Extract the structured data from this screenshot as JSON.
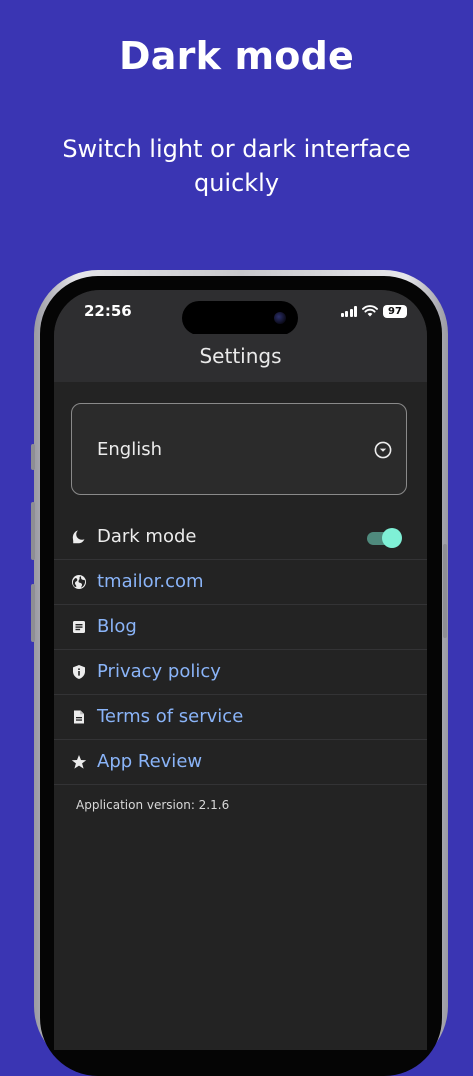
{
  "promo": {
    "headline": "Dark mode",
    "subline": "Switch light or dark interface quickly"
  },
  "status_bar": {
    "time": "22:56",
    "battery": "97"
  },
  "app_bar": {
    "title": "Settings"
  },
  "language_select": {
    "value": "English"
  },
  "menu": [
    {
      "label": "Dark mode",
      "icon": "moon-icon",
      "toggle_on": true
    },
    {
      "label": "tmailor.com",
      "icon": "globe-icon"
    },
    {
      "label": "Blog",
      "icon": "article-icon"
    },
    {
      "label": "Privacy policy",
      "icon": "shield-icon"
    },
    {
      "label": "Terms of service",
      "icon": "document-icon"
    },
    {
      "label": "App Review",
      "icon": "star-icon"
    }
  ],
  "version_text": "Application version: 2.1.6",
  "colors": {
    "background": "#3a35b3",
    "screen": "#232323",
    "appbar": "#2e2e30",
    "link": "#8ab4f8",
    "toggle_thumb": "#7ff0d6",
    "toggle_track": "#4f8a7d"
  }
}
